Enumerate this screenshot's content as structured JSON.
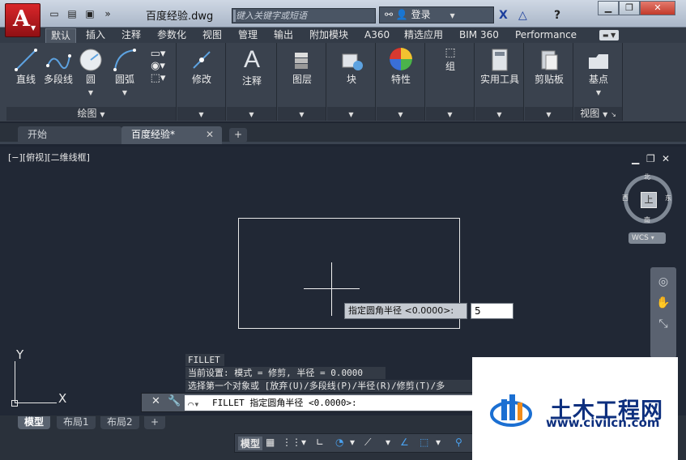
{
  "window": {
    "doc_title": "百度经验.dwg",
    "search_placeholder": "键入关键字或短语",
    "login_label": "登录",
    "win_controls": [
      "▁",
      "❐",
      "✕"
    ]
  },
  "ribbon_tabs": [
    "默认",
    "插入",
    "注释",
    "参数化",
    "视图",
    "管理",
    "输出",
    "附加模块",
    "A360",
    "精选应用",
    "BIM 360",
    "Performance"
  ],
  "ribbon": {
    "draw_tools": [
      "直线",
      "多段线",
      "圆",
      "圆弧"
    ],
    "draw_footer": "绘图",
    "modify": "修改",
    "annotate": "注释",
    "layers": "图层",
    "block": "块",
    "properties": "特性",
    "group": "组",
    "utilities": "实用工具",
    "clipboard": "剪贴板",
    "base": "基点",
    "view_footer": "视图"
  },
  "file_tabs": {
    "start": "开始",
    "doc": "百度经验*",
    "plus": "+"
  },
  "canvas": {
    "view_label": "[−][俯视][二维线框]",
    "viewcube": {
      "top": "上",
      "n": "北",
      "s": "南",
      "e": "东",
      "w": "西"
    },
    "wcs": "WCS",
    "ucs_x": "X",
    "ucs_y": "Y",
    "prompt": "指定圆角半径 <0.0000>:",
    "prompt_value": "5"
  },
  "command": {
    "history": [
      "FILLET",
      "当前设置: 模式 = 修剪, 半径 = 0.0000",
      "选择第一个对象或 [放弃(U)/多段线(P)/半径(R)/修剪(T)/多"
    ],
    "current": "FILLET 指定圆角半径 <0.0000>:"
  },
  "layout_tabs": [
    "模型",
    "布局1",
    "布局2",
    "+"
  ],
  "status": {
    "model": "模型"
  },
  "watermark": {
    "name": "土木工程网",
    "url": "www.civilcn.com"
  }
}
